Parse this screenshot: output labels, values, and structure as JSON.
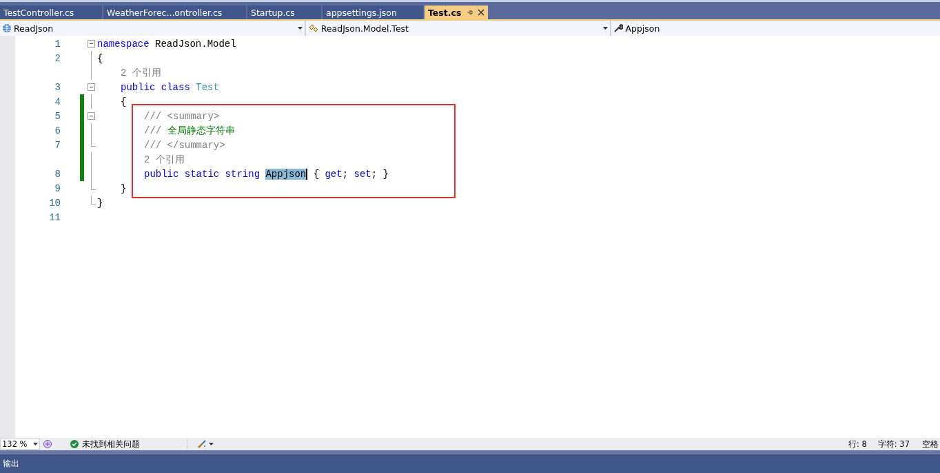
{
  "tabs": [
    {
      "label": "TestController.cs",
      "selected": false
    },
    {
      "label": "WeatherForec...ontroller.cs",
      "selected": false
    },
    {
      "label": "Startup.cs",
      "selected": false
    },
    {
      "label": "appsettings.json",
      "selected": false
    },
    {
      "label": "Test.cs",
      "selected": true
    }
  ],
  "nav_bar": [
    {
      "kind": "project",
      "text": "ReadJson"
    },
    {
      "kind": "class",
      "text": "ReadJson.Model.Test"
    },
    {
      "kind": "member",
      "text": "Appjson"
    }
  ],
  "editor": {
    "annotation": {
      "kind": "rectangle",
      "color": "#e03030"
    },
    "rows": [
      {
        "kind": "code",
        "number": "1",
        "foldable": true,
        "fold_end": false,
        "changed": false,
        "tokens": [
          {
            "kind": "keyword",
            "text": "namespace"
          },
          {
            "kind": "plain",
            "text": " ReadJson.Model"
          }
        ]
      },
      {
        "kind": "code",
        "number": "2",
        "foldable": false,
        "fold_end": false,
        "changed": false,
        "tokens": [
          {
            "kind": "plain",
            "text": "{"
          }
        ],
        "children": [
          {
            "kind": "lens",
            "foldable": false,
            "fold_end": false,
            "changed": false,
            "tokens": [
              {
                "kind": "lens",
                "text": "2 个引用"
              }
            ]
          },
          {
            "kind": "code",
            "number": "3",
            "foldable": true,
            "fold_end": false,
            "changed": false,
            "tokens": [
              {
                "kind": "keyword",
                "text": "public class"
              },
              {
                "kind": "type",
                "text": " Test"
              }
            ]
          },
          {
            "kind": "code",
            "number": "4",
            "foldable": false,
            "fold_end": false,
            "changed": true,
            "tokens": [
              {
                "kind": "plain",
                "text": "{"
              }
            ],
            "children": [
              {
                "kind": "code",
                "number": "5",
                "foldable": true,
                "fold_end": false,
                "changed": true,
                "tokens": [
                  {
                    "kind": "comment",
                    "text": "/// <summary>"
                  }
                ]
              },
              {
                "kind": "code",
                "number": "6",
                "foldable": false,
                "fold_end": false,
                "changed": true,
                "tokens": [
                  {
                    "kind": "comment",
                    "text": "/// "
                  },
                  {
                    "kind": "doc",
                    "text": "全局静态字符串"
                  }
                ]
              },
              {
                "kind": "code",
                "number": "7",
                "foldable": false,
                "fold_end": true,
                "changed": true,
                "tokens": [
                  {
                    "kind": "comment",
                    "text": "/// </summary>"
                  }
                ]
              },
              {
                "kind": "lens",
                "foldable": false,
                "fold_end": false,
                "changed": true,
                "tokens": [
                  {
                    "kind": "lens",
                    "text": "2 个引用"
                  }
                ]
              },
              {
                "kind": "code",
                "number": "8",
                "foldable": false,
                "fold_end": false,
                "changed": true,
                "tokens": [
                  {
                    "kind": "keyword",
                    "text": "public static string "
                  },
                  {
                    "kind": "selected",
                    "text": "Appjson"
                  },
                  {
                    "kind": "plain",
                    "text": " { "
                  },
                  {
                    "kind": "keyword",
                    "text": "get"
                  },
                  {
                    "kind": "plain",
                    "text": "; "
                  },
                  {
                    "kind": "keyword",
                    "text": "set"
                  },
                  {
                    "kind": "plain",
                    "text": "; }"
                  }
                ]
              }
            ]
          },
          {
            "kind": "code",
            "number": "9",
            "foldable": false,
            "fold_end": true,
            "changed": false,
            "tokens": [
              {
                "kind": "plain",
                "text": "}"
              }
            ]
          }
        ]
      },
      {
        "kind": "code",
        "number": "10",
        "foldable": false,
        "fold_end": true,
        "changed": false,
        "tokens": [
          {
            "kind": "plain",
            "text": "}"
          }
        ]
      },
      {
        "kind": "code",
        "number": "11",
        "foldable": false,
        "fold_end": false,
        "changed": false,
        "tokens": []
      }
    ]
  },
  "status_bar": {
    "zoom": "132 %",
    "issues": "未找到相关问题",
    "line": "行: 8",
    "char": "字符: 37",
    "whitespace": "空格"
  },
  "output_panel": {
    "title": "输出"
  }
}
